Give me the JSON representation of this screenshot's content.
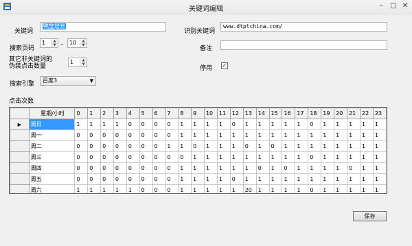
{
  "window": {
    "title": "关键词编辑"
  },
  "form": {
    "keyword_label": "关键词",
    "keyword_value": "鸭宝培元",
    "pages_label": "搜索页码",
    "page_from": "1",
    "page_dash": "–",
    "page_to": "10",
    "other_label_line1": "其它非关键词的",
    "other_label_line2": "伪装点击数量",
    "other_count": "1",
    "engine_label": "搜索引擎",
    "engine_value": "百度3",
    "identify_label": "识别关键词",
    "identify_value": "www.dtptchina.com/",
    "note_label": "备注",
    "note_value": "",
    "disabled_label": "停用",
    "disabled_checked": true
  },
  "grid": {
    "section_label": "点击次数",
    "header_label": "星期/小时",
    "hours": [
      "0",
      "1",
      "2",
      "3",
      "4",
      "5",
      "6",
      "7",
      "8",
      "9",
      "10",
      "11",
      "12",
      "13",
      "14",
      "15",
      "16",
      "17",
      "18",
      "19",
      "20",
      "21",
      "22",
      "23"
    ],
    "rows": [
      {
        "day": "周日",
        "values": [
          "1",
          "1",
          "1",
          "1",
          "0",
          "0",
          "0",
          "0",
          "1",
          "1",
          "1",
          "1",
          "0",
          "1",
          "1",
          "1",
          "1",
          "1",
          "0",
          "1",
          "1",
          "1",
          "1",
          "1"
        ]
      },
      {
        "day": "周一",
        "values": [
          "0",
          "0",
          "0",
          "0",
          "0",
          "0",
          "0",
          "0",
          "1",
          "1",
          "1",
          "1",
          "1",
          "1",
          "1",
          "1",
          "1",
          "1",
          "1",
          "1",
          "1",
          "1",
          "1",
          "1"
        ]
      },
      {
        "day": "周二",
        "values": [
          "0",
          "0",
          "0",
          "0",
          "0",
          "0",
          "0",
          "1",
          "1",
          "0",
          "1",
          "1",
          "1",
          "0",
          "1",
          "0",
          "1",
          "1",
          "1",
          "1",
          "1",
          "1",
          "1",
          "1"
        ]
      },
      {
        "day": "周三",
        "values": [
          "0",
          "0",
          "0",
          "0",
          "0",
          "0",
          "0",
          "0",
          "0",
          "1",
          "1",
          "1",
          "1",
          "1",
          "1",
          "1",
          "1",
          "1",
          "0",
          "1",
          "1",
          "1",
          "1",
          "1"
        ]
      },
      {
        "day": "周四",
        "values": [
          "0",
          "0",
          "0",
          "0",
          "0",
          "0",
          "0",
          "0",
          "1",
          "1",
          "1",
          "1",
          "1",
          "1",
          "0",
          "1",
          "0",
          "1",
          "1",
          "1",
          "1",
          "0",
          "1",
          "1"
        ]
      },
      {
        "day": "周五",
        "values": [
          "0",
          "0",
          "0",
          "0",
          "0",
          "0",
          "0",
          "0",
          "1",
          "1",
          "1",
          "1",
          "0",
          "1",
          "1",
          "1",
          "1",
          "1",
          "1",
          "1",
          "1",
          "1",
          "1",
          "1"
        ]
      },
      {
        "day": "周六",
        "values": [
          "1",
          "1",
          "1",
          "1",
          "1",
          "0",
          "0",
          "0",
          "1",
          "1",
          "1",
          "1",
          "1",
          "20",
          "1",
          "1",
          "1",
          "1",
          "0",
          "1",
          "1",
          "1",
          "1",
          "1"
        ]
      }
    ]
  },
  "buttons": {
    "save": "保存"
  }
}
